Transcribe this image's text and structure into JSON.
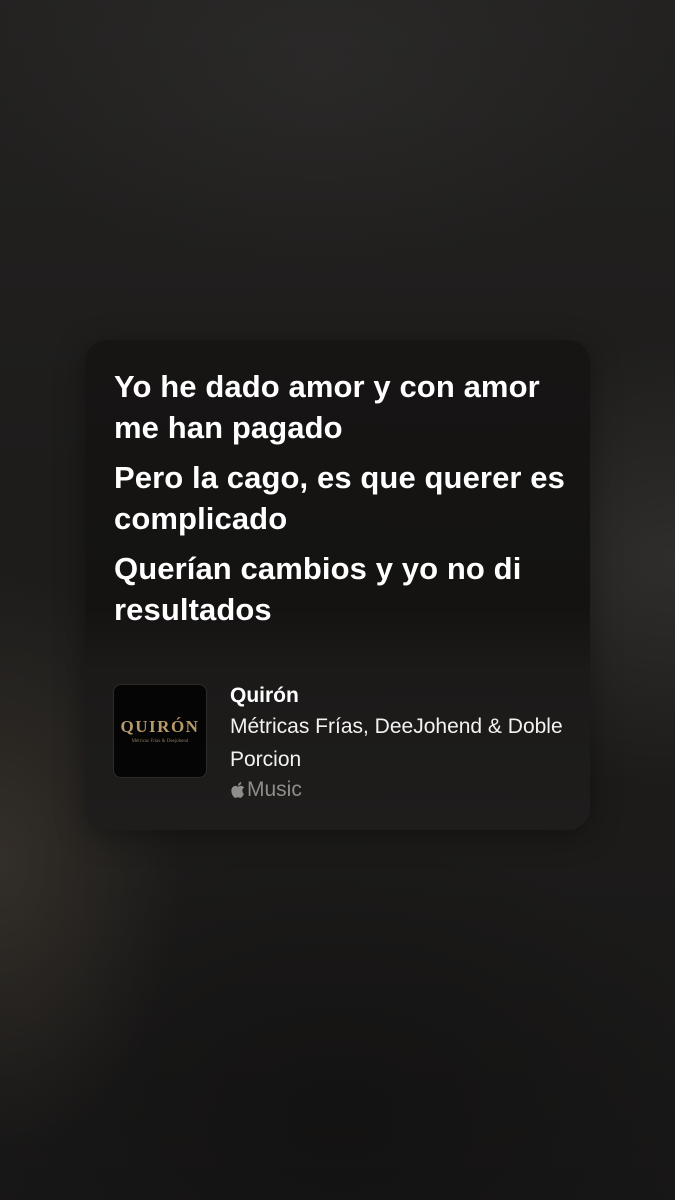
{
  "lyrics_card": {
    "lines": [
      "Yo he dado amor y con amor me han pagado",
      "Pero la cago, es que querer es complicado",
      "Querían cambios y yo no di resultados"
    ]
  },
  "track": {
    "title": "Quirón",
    "artist": "Métricas Frías, DeeJohend & Doble Porcion",
    "service": "Music",
    "artwork": {
      "title": "QUIRÓN",
      "subtitle": "Métricas Frías & Deejohend"
    }
  },
  "colors": {
    "background": "#1f1e1d",
    "card": "#161514",
    "text_primary": "#ffffff",
    "text_muted": "#8e8d8b",
    "artwork_gold": "#b79a6a"
  },
  "icons": {
    "service_logo": "apple-icon"
  }
}
